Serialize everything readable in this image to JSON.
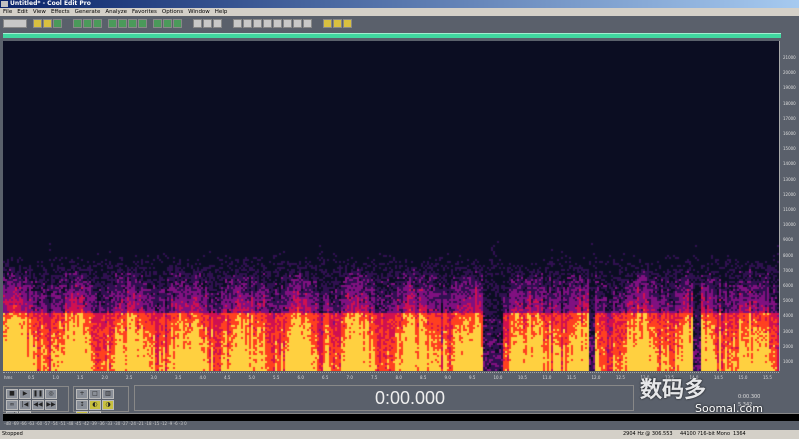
{
  "window": {
    "title": "Untitled* - Cool Edit Pro"
  },
  "menu": [
    "File",
    "Edit",
    "View",
    "Effects",
    "Generate",
    "Analyze",
    "Favorites",
    "Options",
    "Window",
    "Help"
  ],
  "freq_labels": [
    "21000",
    "20000",
    "19000",
    "18000",
    "17000",
    "16000",
    "15000",
    "14000",
    "13000",
    "12000",
    "11000",
    "10000",
    "9000",
    "8000",
    "7000",
    "6000",
    "5000",
    "4000",
    "3000",
    "2000",
    "1000"
  ],
  "time_unit": "hms",
  "time_labels": [
    "0.5",
    "1.0",
    "1.5",
    "2.0",
    "2.5",
    "3.0",
    "3.5",
    "4.0",
    "4.5",
    "5.0",
    "5.5",
    "6.0",
    "6.5",
    "7.0",
    "7.5",
    "8.0",
    "8.5",
    "9.0",
    "9.5",
    "10.0",
    "10.5",
    "11.0",
    "11.5",
    "12.0",
    "12.5",
    "13.0",
    "13.5",
    "14.0",
    "14.5",
    "15.0",
    "15.5"
  ],
  "time_display": "0:00.000",
  "selection": {
    "begin": "0:00.300",
    "length": "5.342"
  },
  "status": {
    "state": "Stopped",
    "cursor": "2904 Hz @ 306.553",
    "format": "44100 ?16-bit Mono",
    "size": "1364"
  },
  "watermark": {
    "text": "数码多",
    "site": "Soomal.com"
  }
}
